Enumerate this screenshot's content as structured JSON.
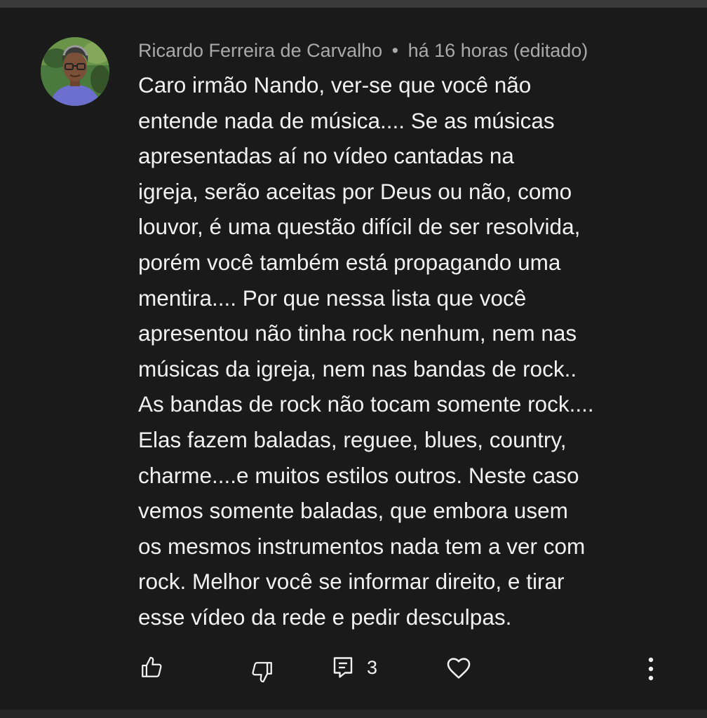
{
  "comment": {
    "author": "Ricardo Ferreira de Carvalho",
    "separator": "•",
    "timestamp": "há 16 horas (editado)",
    "lines": [
      "Caro irmão Nando, ver-se que você não",
      "entende nada de música.... Se as músicas",
      "apresentadas aí no vídeo cantadas na",
      "igreja, serão aceitas por Deus ou não, como",
      "louvor, é uma questão difícil de ser resolvida,",
      "porém você também está propagando uma",
      "mentira.... Por que nessa lista que você",
      "apresentou não tinha rock nenhum, nem nas",
      "músicas da igreja, nem nas bandas de rock..",
      "As bandas de rock não tocam somente rock....",
      "Elas fazem baladas, reguee, blues, country,",
      "charme....e muitos estilos outros. Neste caso",
      "vemos somente baladas, que embora usem",
      "os mesmos instrumentos nada tem a ver com",
      "rock. Melhor você se informar direito, e tirar",
      "esse vídeo da rede e pedir desculpas."
    ]
  },
  "actions": {
    "like_icon": "thumbs-up-icon",
    "dislike_icon": "thumbs-down-icon",
    "reply_icon": "comment-icon",
    "reply_count": "3",
    "heart_icon": "heart-icon",
    "more_icon": "more-vertical-icon"
  },
  "colors": {
    "background": "#1a1a1a",
    "text_primary": "#f1f1f1",
    "text_secondary": "#aaaaaa"
  }
}
